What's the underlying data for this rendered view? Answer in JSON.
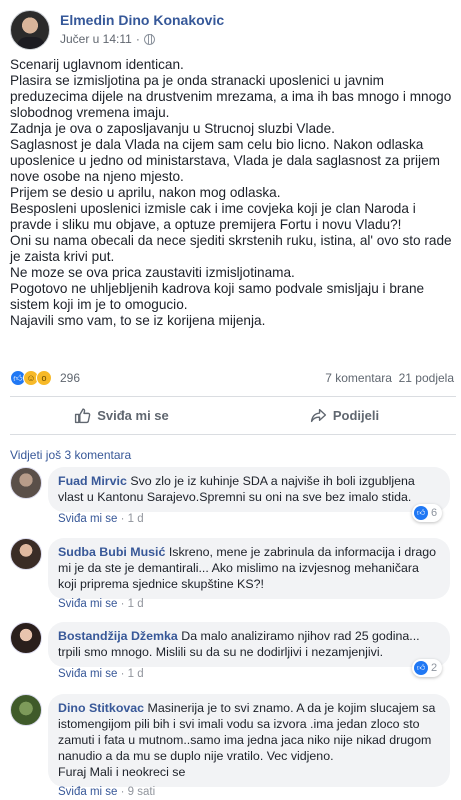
{
  "post": {
    "author": "Elmedin Dino Konakovic",
    "timestamp": "Jučer u 14:11",
    "separator": "·",
    "privacy_icon": "globe-icon",
    "paragraphs": [
      "Scenarij uglavnom identican.",
      "Plasira se izmisljotina pa je onda stranacki uposlenici u javnim preduzecima dijele na drustvenim mrezama, a ima ih bas mnogo i mnogo slobodnog vremena imaju.",
      "Zadnja je ova o zaposljavanju u Strucnoj sluzbi Vlade.",
      "Saglasnost je dala Vlada na cijem sam celu bio licno. Nakon odlaska uposlenice u jedno od ministarstava, Vlada je dala saglasnost za prijem nove osobe na njeno mjesto.",
      "Prijem se desio u aprilu, nakon mog odlaska.",
      "Besposleni uposlenici izmisle cak i ime covjeka koji je clan Naroda i pravde i sliku mu objave, a optuze premijera Fortu i novu Vladu?!",
      "Oni su nama obecali da nece sjediti skrstenih ruku, istina, al' ovo sto rade je zaista krivi put.",
      "Ne moze se ova prica zaustaviti izmisljotinama.",
      "Pogotovo ne uhljebljenih kadrova koji samo podvale smisljaju i brane sistem koji im je to omogucio.",
      "Najavili smo vam, to se iz korijena mijenja."
    ],
    "reaction_count": "296",
    "comments_count": "7 komentara",
    "shares_count": "21 podjela"
  },
  "actions": {
    "like_label": "Sviđa mi se",
    "share_label": "Podijeli"
  },
  "comments_section": {
    "view_more": "Vidjeti još 3 komentara",
    "like_label": "Sviđa mi se",
    "items": [
      {
        "name": "Fuad Mirvic",
        "text": "Svo zlo je iz kuhinje SDA a najviše ih boli izgubljena vlast u Kantonu Sarajevo.Spremni su oni na sve bez imalo stida.",
        "time": "1 d",
        "reaction_count": "6"
      },
      {
        "name": "Sudba Bubi Musić",
        "text": "Iskreno, mene je zabrinula da informacija i drago mi je da ste je demantirali... Ako mislimo na izvjesnog mehaničara koji priprema sjednice skupštine KS?!",
        "time": "1 d",
        "reaction_count": ""
      },
      {
        "name": "Bostandžija Džemka",
        "text": "Da malo analiziramo njihov rad 25 godina... trpili smo mnogo. Mislili su da su ne dodirljivi i nezamjenjivi.",
        "time": "1 d",
        "reaction_count": "2"
      },
      {
        "name": "Dino Stitkovac",
        "text": "Masinerija je to svi znamo. A da je kojim slucajem sa istomengijom pili bih i svi imali vodu sa izvora .ima jedan zloco sto zamuti i fata u mutnom..samo ima jedna jaca niko nije nikad drugom nanudio a da mu se duplo nije vratilo. Vec vidjeno.",
        "text2": "Furaj Mali i neokreci se",
        "time": "9 sati",
        "reaction_count": ""
      }
    ]
  },
  "colors": {
    "link_blue": "#385898",
    "like_blue": "#2078f4",
    "bubble_gray": "#f2f3f5"
  }
}
